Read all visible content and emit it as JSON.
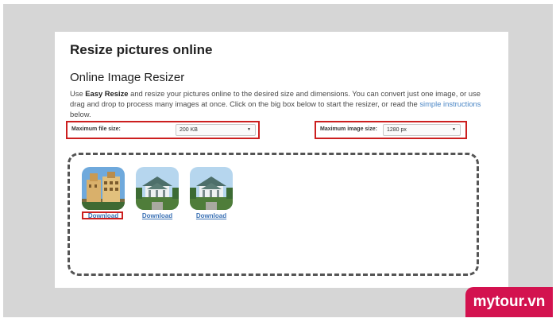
{
  "page": {
    "title": "Resize pictures online",
    "section_title": "Online Image Resizer",
    "intro": {
      "prefix": "Use ",
      "brand": "Easy Resize",
      "body": " and resize your pictures online to the desired size and dimensions. You can convert just one image, or use drag and drop to process many images at once. Click on the big box below to start the resizer, or read the ",
      "link": "simple instructions",
      "suffix": " below."
    }
  },
  "settings": {
    "file_size": {
      "label": "Maximum file size:",
      "value": "200 KB"
    },
    "image_size": {
      "label": "Maximum image size:",
      "value": "1280 px"
    }
  },
  "images": [
    {
      "download_label": "Download"
    },
    {
      "download_label": "Download"
    },
    {
      "download_label": "Download"
    }
  ],
  "watermark": "mytour.vn",
  "colors": {
    "highlight": "#cc1f1f",
    "link": "#3c72b5",
    "watermark_bg": "#d3124f"
  }
}
